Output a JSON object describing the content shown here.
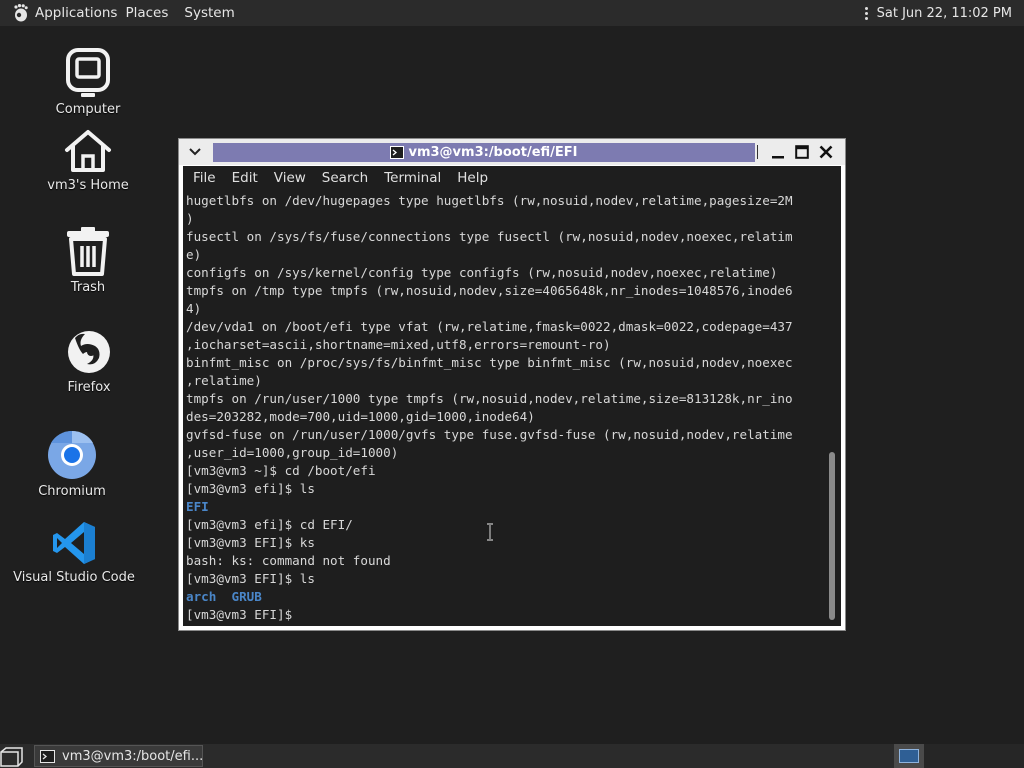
{
  "top_panel": {
    "menus": [
      "Applications",
      "Places",
      "System"
    ],
    "clock": "Sat Jun 22, 11:02 PM"
  },
  "desktop": {
    "icons": [
      {
        "label": "Computer",
        "icon": "computer-icon"
      },
      {
        "label": "vm3's Home",
        "icon": "home-icon"
      },
      {
        "label": "Trash",
        "icon": "trash-icon"
      },
      {
        "label": "Firefox",
        "icon": "firefox-icon"
      },
      {
        "label": "Chromium",
        "icon": "chromium-icon"
      },
      {
        "label": "Visual Studio Code",
        "icon": "vscode-icon"
      }
    ]
  },
  "terminal": {
    "title": "vm3@vm3:/boot/efi/EFI",
    "menu": [
      "File",
      "Edit",
      "View",
      "Search",
      "Terminal",
      "Help"
    ],
    "lines": [
      "hugetlbfs on /dev/hugepages type hugetlbfs (rw,nosuid,nodev,relatime,pagesize=2M",
      ")",
      "fusectl on /sys/fs/fuse/connections type fusectl (rw,nosuid,nodev,noexec,relatim",
      "e)",
      "configfs on /sys/kernel/config type configfs (rw,nosuid,nodev,noexec,relatime)",
      "tmpfs on /tmp type tmpfs (rw,nosuid,nodev,size=4065648k,nr_inodes=1048576,inode6",
      "4)",
      "/dev/vda1 on /boot/efi type vfat (rw,relatime,fmask=0022,dmask=0022,codepage=437",
      ",iocharset=ascii,shortname=mixed,utf8,errors=remount-ro)",
      "binfmt_misc on /proc/sys/fs/binfmt_misc type binfmt_misc (rw,nosuid,nodev,noexec",
      ",relatime)",
      "tmpfs on /run/user/1000 type tmpfs (rw,nosuid,nodev,relatime,size=813128k,nr_ino",
      "des=203282,mode=700,uid=1000,gid=1000,inode64)",
      "gvfsd-fuse on /run/user/1000/gvfs type fuse.gvfsd-fuse (rw,nosuid,nodev,relatime",
      ",user_id=1000,group_id=1000)",
      "[vm3@vm3 ~]$ cd /boot/efi",
      "[vm3@vm3 efi]$ ls",
      "EFI",
      "[vm3@vm3 efi]$ cd EFI/",
      "[vm3@vm3 EFI]$ ks",
      "bash: ks: command not found",
      "[vm3@vm3 EFI]$ ls",
      "arch  GRUB",
      "[vm3@vm3 EFI]$ "
    ],
    "colored_lines": [
      17,
      22
    ],
    "dir_color": "#4a86c8"
  },
  "taskbar": {
    "task_label": "vm3@vm3:/boot/efi..."
  }
}
